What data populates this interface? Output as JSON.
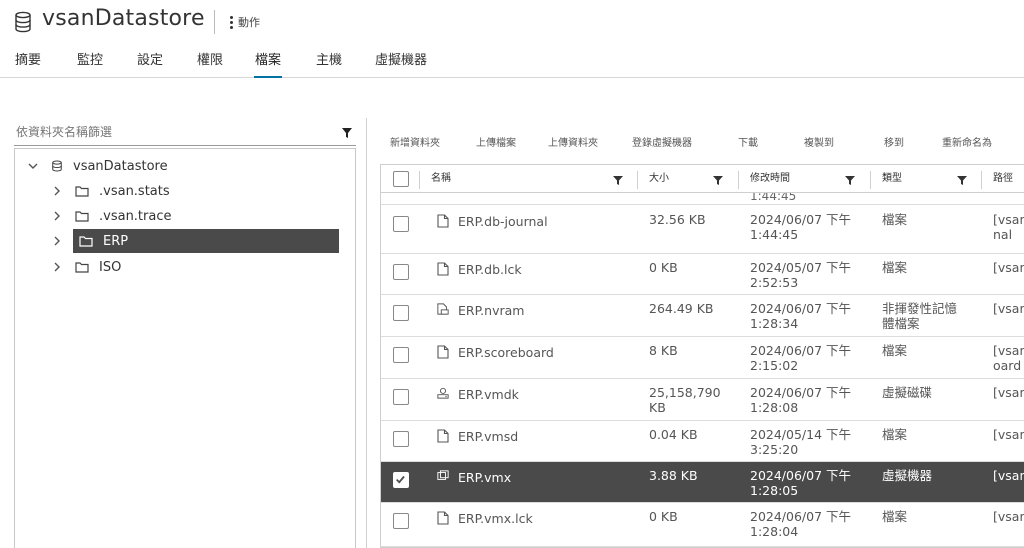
{
  "header": {
    "title": "vsanDatastore",
    "actions_label": "動作",
    "title_icon": "database-icon"
  },
  "tabs": [
    {
      "label": "摘要"
    },
    {
      "label": "監控"
    },
    {
      "label": "設定"
    },
    {
      "label": "權限"
    },
    {
      "label": "檔案",
      "active": true
    },
    {
      "label": "主機"
    },
    {
      "label": "虛擬機器"
    }
  ],
  "filter": {
    "placeholder": "依資料夾名稱篩選"
  },
  "tree": {
    "root": "vsanDatastore",
    "items": [
      {
        "label": ".vsan.stats"
      },
      {
        "label": ".vsan.trace"
      },
      {
        "label": "ERP",
        "selected": true
      },
      {
        "label": "ISO"
      }
    ]
  },
  "toolbar": {
    "new_folder": "新增資料夾",
    "upload_files": "上傳檔案",
    "upload_folder": "上傳資料夾",
    "register_vm": "登錄虛擬機器",
    "download": "下載",
    "copy_to": "複製到",
    "move_to": "移到",
    "rename": "重新命名為"
  },
  "grid": {
    "columns": {
      "name": "名稱",
      "size": "大小",
      "modified": "修改時間",
      "type": "類型",
      "path": "路徑"
    },
    "partial_row_time": "1:44:45",
    "rows": [
      {
        "name": "ERP.db-journal",
        "icon": "file-icon",
        "size": "32.56 KB",
        "size2": "",
        "date": "2024/06/07 下午",
        "time": "1:44:45",
        "type": "檔案",
        "type2": "",
        "path": "[vsan",
        "path2": "nal"
      },
      {
        "name": "ERP.db.lck",
        "icon": "file-icon",
        "size": "0 KB",
        "size2": "",
        "date": "2024/05/07 下午",
        "time": "2:52:53",
        "type": "檔案",
        "type2": "",
        "path": "[vsan",
        "path2": ""
      },
      {
        "name": "ERP.nvram",
        "icon": "nvram-file-icon",
        "size": "264.49 KB",
        "size2": "",
        "date": "2024/06/07 下午",
        "time": "1:28:34",
        "type": "非揮發性記憶",
        "type2": "體檔案",
        "path": "[vsan",
        "path2": ""
      },
      {
        "name": "ERP.scoreboard",
        "icon": "file-icon",
        "size": "8 KB",
        "size2": "",
        "date": "2024/06/07 下午",
        "time": "2:15:02",
        "type": "檔案",
        "type2": "",
        "path": "[vsan",
        "path2": "oard"
      },
      {
        "name": "ERP.vmdk",
        "icon": "virtual-disk-icon",
        "size": "25,158,790",
        "size2": "KB",
        "date": "2024/06/07 下午",
        "time": "1:28:08",
        "type": "虛擬磁碟",
        "type2": "",
        "path": "[vsan",
        "path2": ""
      },
      {
        "name": "ERP.vmsd",
        "icon": "file-icon",
        "size": "0.04 KB",
        "size2": "",
        "date": "2024/05/14 下午",
        "time": "3:25:20",
        "type": "檔案",
        "type2": "",
        "path": "[vsan",
        "path2": ""
      },
      {
        "name": "ERP.vmx",
        "icon": "vm-config-icon",
        "size": "3.88 KB",
        "size2": "",
        "date": "2024/06/07 下午",
        "time": "1:28:05",
        "type": "虛擬機器",
        "type2": "",
        "path": "[vsan",
        "path2": "",
        "selected": true
      },
      {
        "name": "ERP.vmx.lck",
        "icon": "file-icon",
        "size": "0 KB",
        "size2": "",
        "date": "2024/06/07 下午",
        "time": "1:28:04",
        "type": "檔案",
        "type2": "",
        "path": "[vsan",
        "path2": ""
      }
    ]
  }
}
